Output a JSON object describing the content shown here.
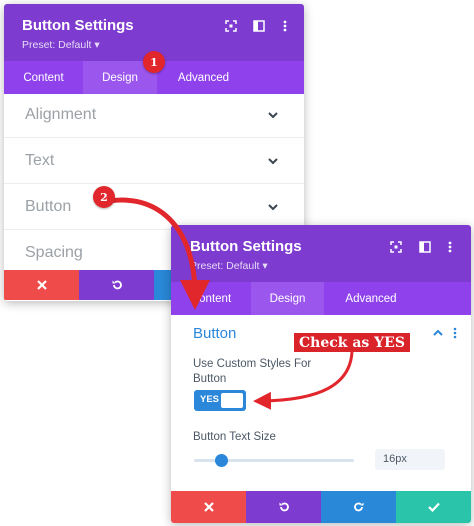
{
  "colors": {
    "header": "#7e3bd0",
    "tabs": "#8f42ec",
    "active_tab": "#9b56ee",
    "accent_blue": "#2b87da",
    "cancel": "#ef4b4b",
    "undo": "#7e3bd0",
    "redo": "#2a88d8",
    "save": "#29c4a9",
    "annotation_red": "#e1262c"
  },
  "panel1": {
    "title": "Button Settings",
    "preset": "Preset: Default ▾",
    "header_icons": [
      "expand-icon",
      "sidebar-icon",
      "more-vertical-icon"
    ],
    "tabs": [
      {
        "label": "Content",
        "active": false
      },
      {
        "label": "Design",
        "active": true
      },
      {
        "label": "Advanced",
        "active": false
      }
    ],
    "sections": [
      {
        "label": "Alignment"
      },
      {
        "label": "Text"
      },
      {
        "label": "Button"
      },
      {
        "label": "Spacing"
      }
    ]
  },
  "panel2": {
    "title": "Button Settings",
    "preset": "Preset: Default ▾",
    "header_icons": [
      "expand-icon",
      "sidebar-icon",
      "more-vertical-icon"
    ],
    "tabs": [
      {
        "label": "Content",
        "active": false
      },
      {
        "label": "Design",
        "active": true
      },
      {
        "label": "Advanced",
        "active": false
      }
    ],
    "section_title": "Button",
    "custom_styles_label_line1": "Use Custom Styles For",
    "custom_styles_label_line2": "Button",
    "toggle_value": "YES",
    "text_size_label": "Button Text Size",
    "text_size_value": "16px"
  },
  "annotations": {
    "badge1": "1",
    "badge2": "2",
    "callout": "Check as YES"
  }
}
